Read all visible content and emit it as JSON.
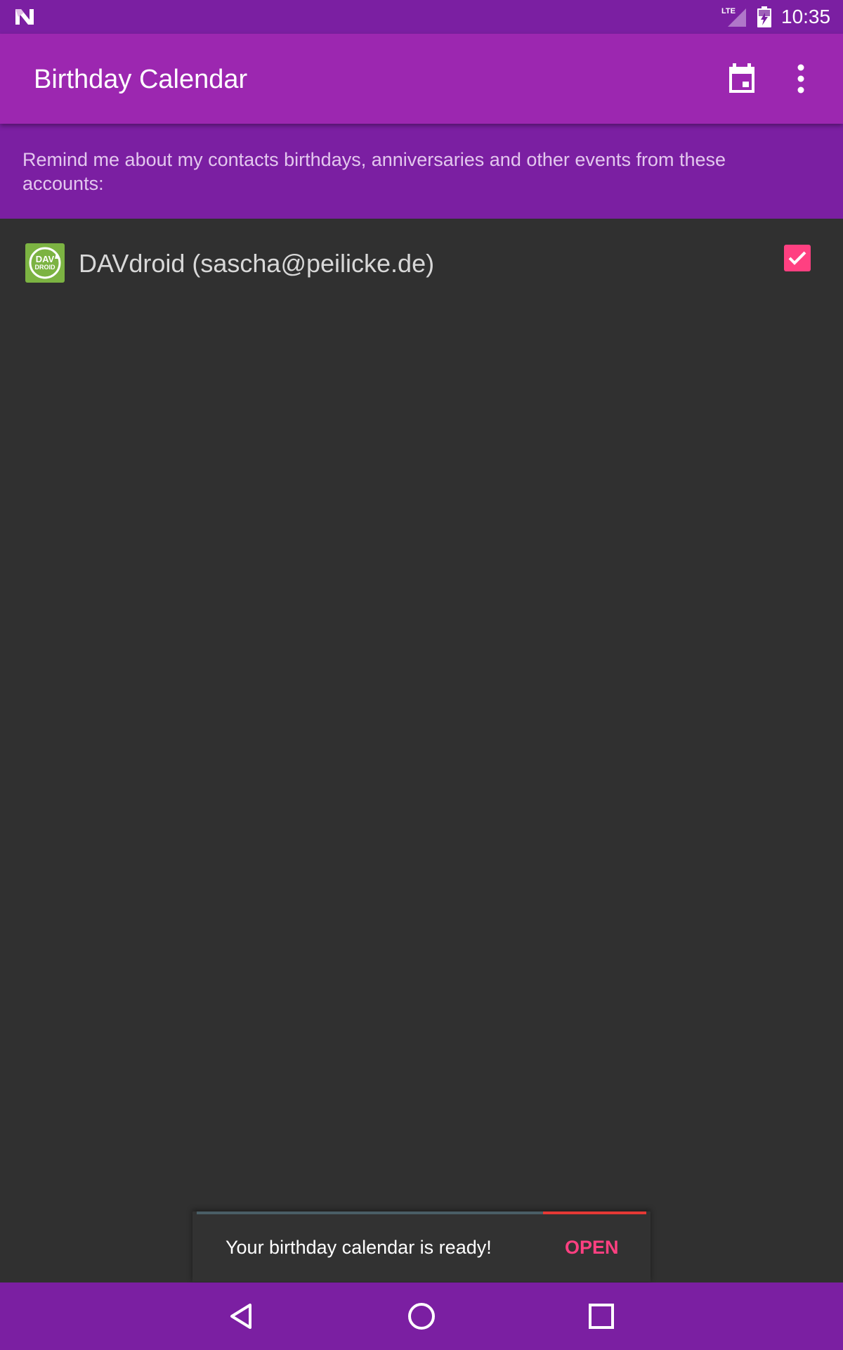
{
  "status_bar": {
    "time": "10:35",
    "network": "LTE",
    "icons": [
      "android-n-icon",
      "lte-signal-icon",
      "battery-charging-icon"
    ]
  },
  "app_bar": {
    "title": "Birthday Calendar",
    "actions": [
      "calendar-icon",
      "more-vert-icon"
    ]
  },
  "header": {
    "text": "Remind me about my contacts birthdays, anniversaries and other events from these accounts:"
  },
  "accounts": [
    {
      "label": "DAVdroid (sascha@peilicke.de)",
      "icon_text": [
        "DAV",
        "DROID"
      ],
      "checked": true
    }
  ],
  "snackbar": {
    "message": "Your birthday calendar is ready!",
    "action": "OPEN",
    "progress": 0.77
  },
  "colors": {
    "primary": "#9c27b0",
    "primary_dark": "#7b1fa2",
    "accent": "#ff4081",
    "background": "#303030",
    "account_icon": "#7cb342"
  },
  "nav_bar": {
    "buttons": [
      "back-icon",
      "home-icon",
      "recents-icon"
    ]
  }
}
